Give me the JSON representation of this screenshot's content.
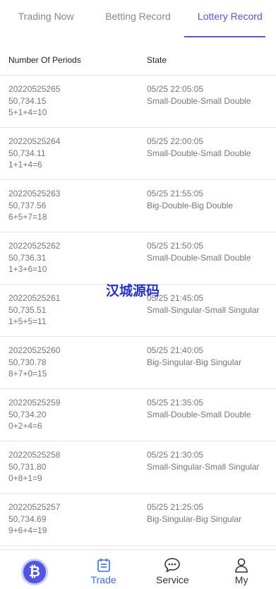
{
  "tabs": [
    "Trading Now",
    "Betting Record",
    "Lottery Record"
  ],
  "active_tab": "Lottery Record",
  "table": {
    "headers": [
      "Number Of Periods",
      "State"
    ],
    "rows": [
      {
        "period": "20220525265",
        "value": "50,734.15",
        "sum": "5+1+4=10",
        "time": "05/25 22:05:05",
        "state": "Small-Double-Small Double"
      },
      {
        "period": "20220525264",
        "value": "50,734.11",
        "sum": "1+1+4=6",
        "time": "05/25 22:00:05",
        "state": "Small-Double-Small Double"
      },
      {
        "period": "20220525263",
        "value": "50,737.56",
        "sum": "6+5+7=18",
        "time": "05/25 21:55:05",
        "state": "Big-Double-Big Double"
      },
      {
        "period": "20220525262",
        "value": "50,736.31",
        "sum": "1+3+6=10",
        "time": "05/25 21:50:05",
        "state": "Small-Double-Small Double"
      },
      {
        "period": "20220525261",
        "value": "50,735.51",
        "sum": "1+5+5=11",
        "time": "05/25 21:45:05",
        "state": "Small-Singular-Small Singular"
      },
      {
        "period": "20220525260",
        "value": "50,730.78",
        "sum": "8+7+0=15",
        "time": "05/25 21:40:05",
        "state": "Big-Singular-Big Singular"
      },
      {
        "period": "20220525259",
        "value": "50,734.20",
        "sum": "0+2+4=6",
        "time": "05/25 21:35:05",
        "state": "Small-Double-Small Double"
      },
      {
        "period": "20220525258",
        "value": "50,731.80",
        "sum": "0+8+1=9",
        "time": "05/25 21:30:05",
        "state": "Small-Singular-Small Singular"
      },
      {
        "period": "20220525257",
        "value": "50,734.69",
        "sum": "9+6+4=19",
        "time": "05/25 21:25:05",
        "state": "Big-Singular-Big Singular"
      }
    ]
  },
  "watermark": "汉城源码",
  "bottom_nav": [
    {
      "label": "",
      "icon": "bitcoin-icon"
    },
    {
      "label": "Trade",
      "icon": "trade-icon"
    },
    {
      "label": "Service",
      "icon": "chat-icon"
    },
    {
      "label": "My",
      "icon": "user-icon"
    }
  ],
  "colors": {
    "accent": "#6a4cd8",
    "nav_active": "#3b6fe0",
    "watermark": "#2233cc"
  }
}
